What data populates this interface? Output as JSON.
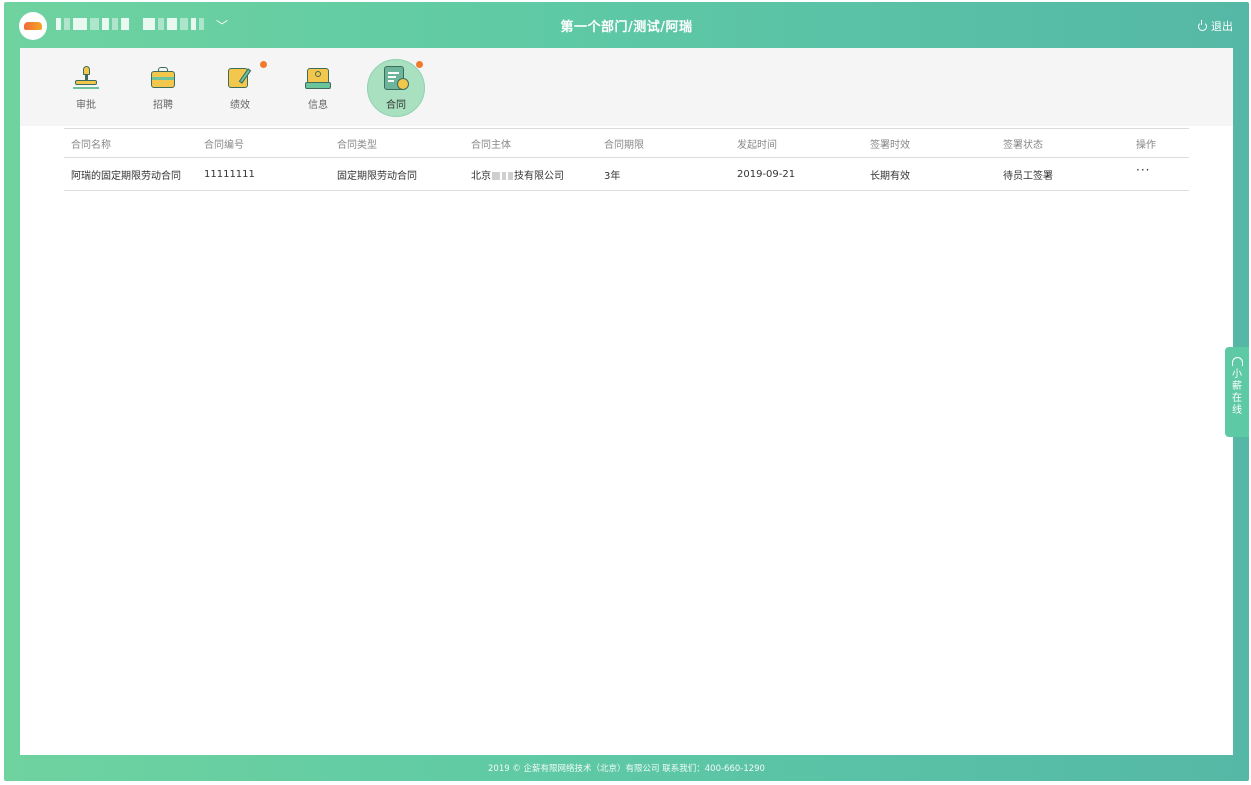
{
  "topbar": {
    "breadcrumb": "第一个部门/测试/阿瑞",
    "logout_label": "退出"
  },
  "nav": {
    "items": [
      {
        "label": "审批",
        "icon": "stamp-icon",
        "badge": false
      },
      {
        "label": "招聘",
        "icon": "briefcase-icon",
        "badge": false
      },
      {
        "label": "绩效",
        "icon": "performance-chart-icon",
        "badge": true
      },
      {
        "label": "信息",
        "icon": "info-card-icon",
        "badge": false
      },
      {
        "label": "合同",
        "icon": "contract-document-icon",
        "badge": true,
        "active": true
      }
    ]
  },
  "table": {
    "headers": [
      "合同名称",
      "合同编号",
      "合同类型",
      "合同主体",
      "合同期限",
      "发起时间",
      "签署时效",
      "签署状态",
      "操作"
    ],
    "rows": [
      {
        "name": "阿瑞的固定期限劳动合同",
        "number": "11111111",
        "type": "固定期限劳动合同",
        "entity_prefix": "北京",
        "entity_suffix": "技有限公司",
        "term": "3年",
        "start_date": "2019-09-21",
        "validity": "长期有效",
        "status": "待员工签署",
        "actions_label": "···"
      }
    ]
  },
  "side_help": {
    "label": "小薪在线",
    "icon": "headset-icon"
  },
  "footer": {
    "text": "2019 © 企薪有限网络技术（北京）有限公司    联系我们：400-660-1290"
  },
  "colors": {
    "brand": "#5ec9a5",
    "active_bubble": "#a8e0c0",
    "badge": "#f07a2d"
  }
}
